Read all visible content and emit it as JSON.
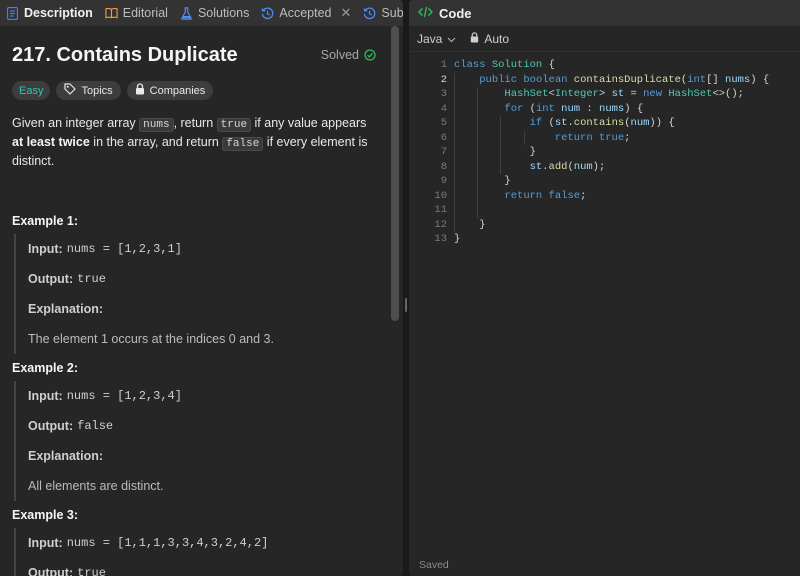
{
  "tabs": [
    {
      "label": "Description",
      "icon": "description-icon",
      "active": true
    },
    {
      "label": "Editorial",
      "icon": "book-icon"
    },
    {
      "label": "Solutions",
      "icon": "flask-icon"
    },
    {
      "label": "Accepted",
      "icon": "history-icon"
    },
    {
      "label": "Submis",
      "icon": "history-icon"
    }
  ],
  "problem": {
    "title": "217. Contains Duplicate",
    "status": "Solved",
    "difficulty": "Easy",
    "topics_label": "Topics",
    "companies_label": "Companies",
    "desc": {
      "t1": "Given an integer array ",
      "c1": "nums",
      "t2": ", return ",
      "c2": "true",
      "t3": " if any value appears ",
      "b1": "at least twice",
      "t4": " in the array, and return ",
      "c3": "false",
      "t5": " if every element is distinct."
    },
    "examples": [
      {
        "title": "Example 1:",
        "input_label": "Input:",
        "input": "nums = [1,2,3,1]",
        "output_label": "Output:",
        "output": "true",
        "explanation_label": "Explanation:",
        "explanation": "The element 1 occurs at the indices 0 and 3."
      },
      {
        "title": "Example 2:",
        "input_label": "Input:",
        "input": "nums = [1,2,3,4]",
        "output_label": "Output:",
        "output": "false",
        "explanation_label": "Explanation:",
        "explanation": "All elements are distinct."
      },
      {
        "title": "Example 3:",
        "input_label": "Input:",
        "input": "nums = [1,1,1,3,3,4,3,2,4,2]",
        "output_label": "Output:",
        "output": "true"
      }
    ]
  },
  "code_panel": {
    "title": "Code",
    "language": "Java",
    "mode": "Auto",
    "status": "Saved",
    "line_numbers": [
      "1",
      "2",
      "3",
      "4",
      "5",
      "6",
      "7",
      "8",
      "9",
      "10",
      "11",
      "12",
      "13"
    ],
    "current_line": 2
  },
  "colors": {
    "easy": "#2fc5b5",
    "solved_check": "#2cbb5d",
    "accent_code_icon": "#2cbb5d",
    "description_icon": "#3b82f6",
    "editorial_icon": "#f0a03c",
    "solutions_icon": "#4f8df5",
    "history_icon": "#4f8df5"
  }
}
